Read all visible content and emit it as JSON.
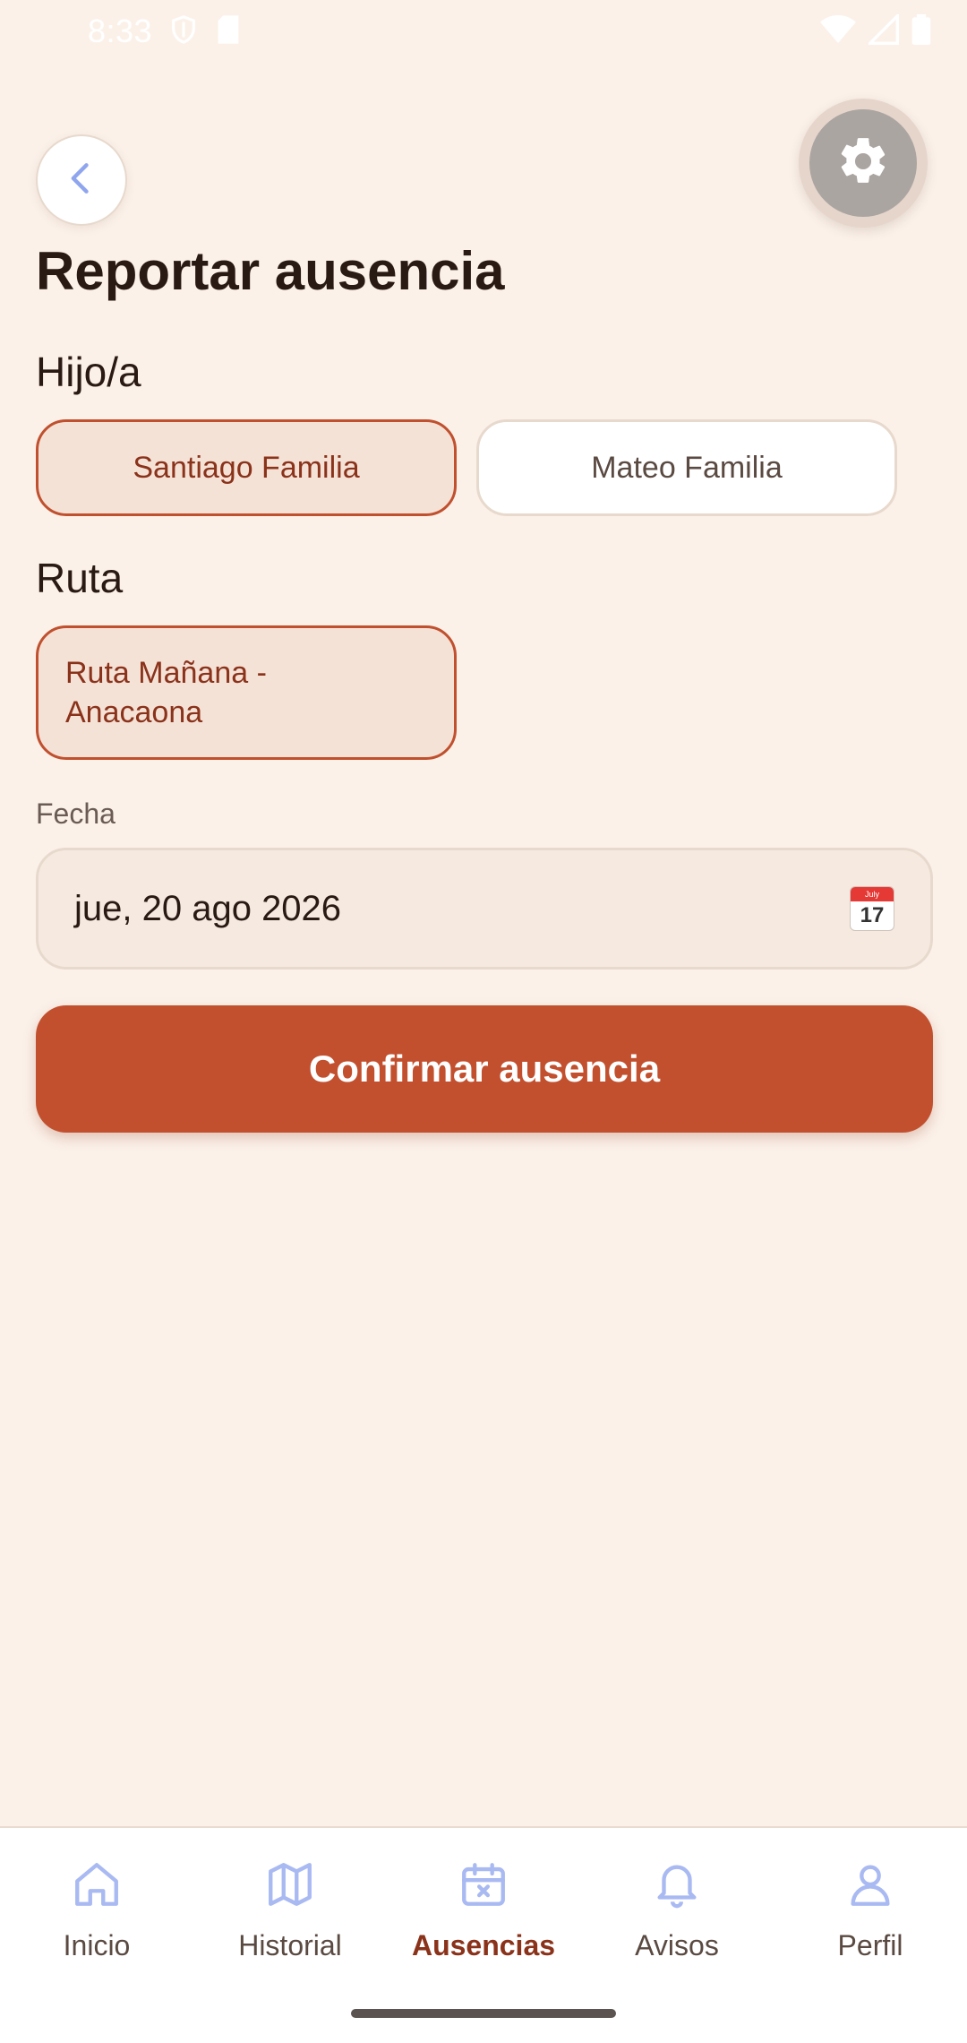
{
  "status_bar": {
    "time": "8:33"
  },
  "header": {
    "title": "Reportar ausencia"
  },
  "child_section": {
    "label": "Hijo/a",
    "options": [
      {
        "name": "Santiago Familia",
        "selected": true
      },
      {
        "name": "Mateo Familia",
        "selected": false
      }
    ]
  },
  "route_section": {
    "label": "Ruta",
    "options": [
      {
        "line1": "Ruta Mañana -",
        "line2": "Anacaona",
        "selected": true
      }
    ]
  },
  "date_field": {
    "label": "Fecha",
    "value": "jue, 20 ago 2026",
    "calendar_month": "July",
    "calendar_day": "17"
  },
  "confirm_button": {
    "label": "Confirmar ausencia"
  },
  "bottom_nav": {
    "items": [
      {
        "label": "Inicio",
        "icon": "home-icon",
        "active": false
      },
      {
        "label": "Historial",
        "icon": "map-icon",
        "active": false
      },
      {
        "label": "Ausencias",
        "icon": "calendar-x-icon",
        "active": true
      },
      {
        "label": "Avisos",
        "icon": "bell-icon",
        "active": false
      },
      {
        "label": "Perfil",
        "icon": "user-icon",
        "active": false
      }
    ]
  },
  "colors": {
    "background": "#FBF1E9",
    "accent": "#C2502E",
    "chip_selected_bg": "#F5E2D7",
    "chip_selected_text": "#8A321A",
    "nav_icon": "#A9B9F2"
  }
}
